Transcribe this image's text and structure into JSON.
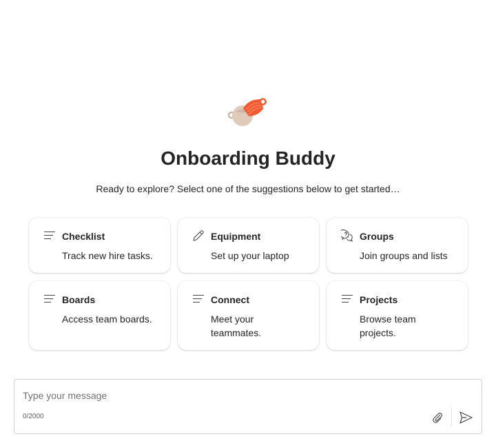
{
  "header": {
    "title": "Onboarding Buddy",
    "subtitle": "Ready to explore? Select one of the suggestions below to get started…"
  },
  "suggestions": [
    {
      "icon": "lines-icon",
      "title": "Checklist",
      "description": "Track new hire tasks."
    },
    {
      "icon": "pencil-icon",
      "title": "Equipment",
      "description": "Set up your laptop"
    },
    {
      "icon": "chat-question-icon",
      "title": "Groups",
      "description": "Join groups and lists"
    },
    {
      "icon": "lines-icon",
      "title": "Boards",
      "description": "Access team boards."
    },
    {
      "icon": "lines-icon",
      "title": "Connect",
      "description": "Meet your teammates."
    },
    {
      "icon": "lines-icon",
      "title": "Projects",
      "description": "Browse team projects."
    }
  ],
  "composer": {
    "placeholder": "Type your message",
    "value": "",
    "counter": "0/2000"
  },
  "colors": {
    "accent": "#f25a32",
    "text": "#242424"
  }
}
